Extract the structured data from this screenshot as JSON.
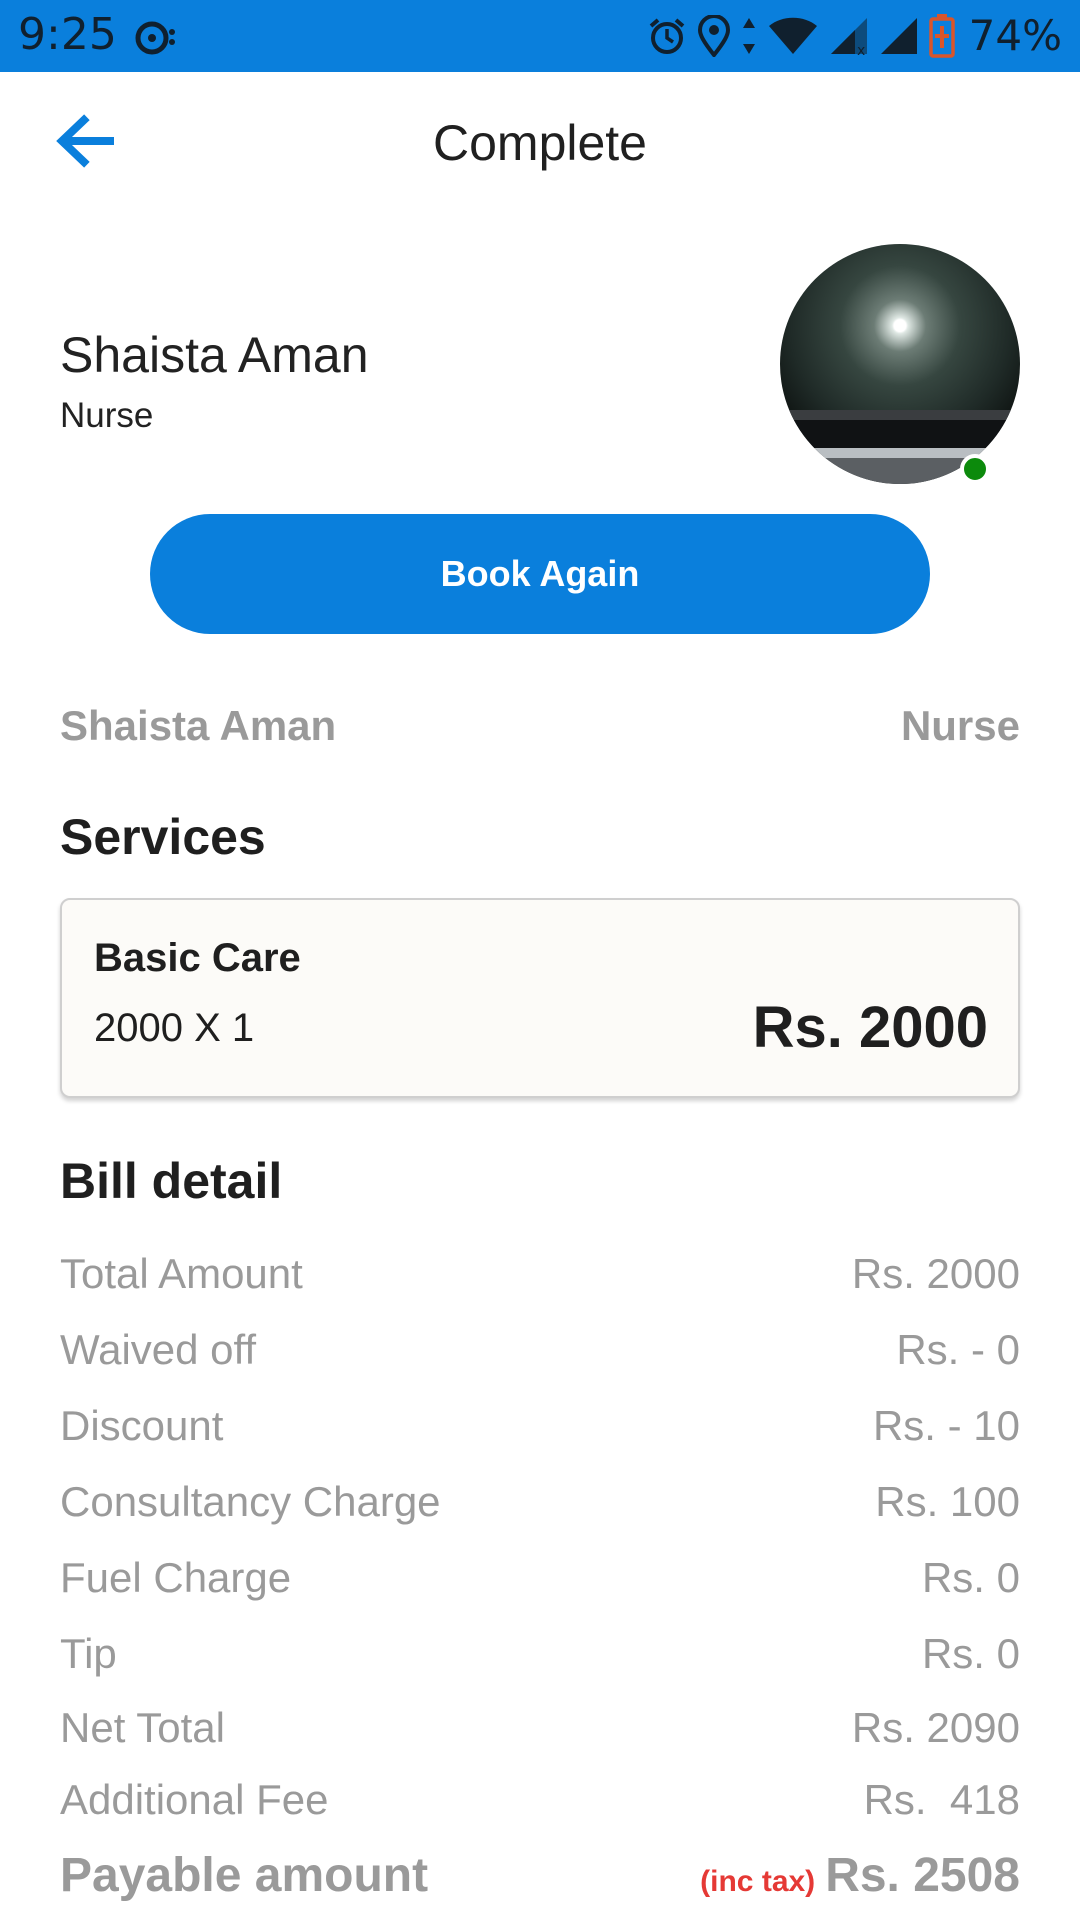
{
  "status_bar": {
    "time": "9:25",
    "battery": "74%",
    "icons": [
      "cast-icon",
      "alarm-icon",
      "location-icon",
      "data-arrows-icon",
      "wifi-icon",
      "signal-icon",
      "signal-icon",
      "battery-charging-icon"
    ],
    "background": "#0a7fdc"
  },
  "header": {
    "title": "Complete",
    "back_icon": "arrow-left-icon"
  },
  "profile": {
    "name": "Shaista Aman",
    "role": "Nurse",
    "status_color": "#0c8a0c"
  },
  "actions": {
    "book_again_label": "Book Again",
    "button_color": "#0a7fdc"
  },
  "summary": {
    "name": "Shaista Aman",
    "role": "Nurse"
  },
  "services": {
    "heading": "Services",
    "items": [
      {
        "name": "Basic Care",
        "qty": "2000 X 1",
        "price": "Rs. 2000"
      }
    ]
  },
  "bill": {
    "heading": "Bill detail",
    "rows": [
      {
        "label": "Total Amount",
        "value": "Rs. 2000"
      },
      {
        "label": "Waived off",
        "value": "Rs. - 0"
      },
      {
        "label": "Discount",
        "value": "Rs. - 10"
      },
      {
        "label": "Consultancy Charge",
        "value": "Rs. 100"
      },
      {
        "label": "Fuel Charge",
        "value": "Rs. 0"
      },
      {
        "label": "Tip",
        "value": "Rs. 0"
      },
      {
        "label": "Net Total",
        "value": "Rs. 2090"
      },
      {
        "label": "Additional Fee",
        "value": "Rs.  418"
      }
    ],
    "payable": {
      "label": "Payable amount",
      "tax_note": "(inc tax)",
      "value": "Rs. 2508",
      "tax_color": "#e53935"
    }
  }
}
